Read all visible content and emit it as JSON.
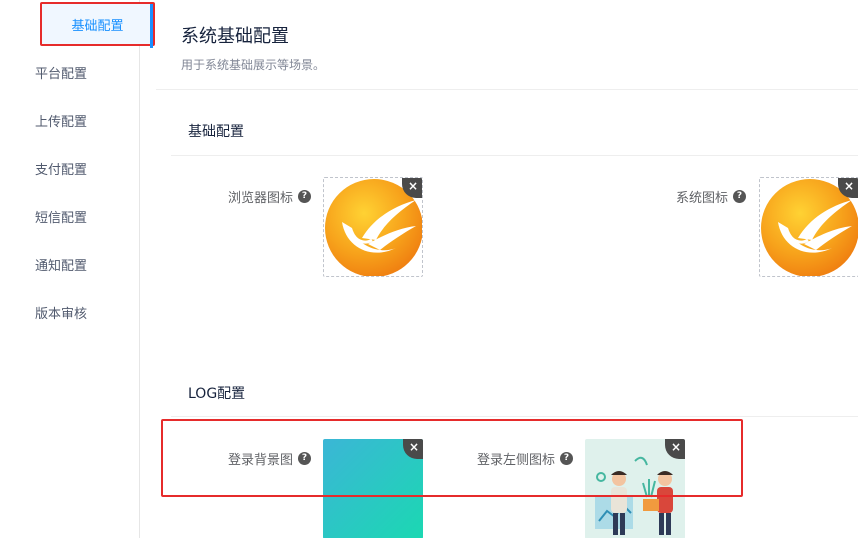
{
  "sidebar": {
    "items": [
      {
        "label": "基础配置"
      },
      {
        "label": "平台配置"
      },
      {
        "label": "上传配置"
      },
      {
        "label": "支付配置"
      },
      {
        "label": "短信配置"
      },
      {
        "label": "通知配置"
      },
      {
        "label": "版本审核"
      }
    ]
  },
  "header": {
    "title": "系统基础配置",
    "description": "用于系统基础展示等场景。"
  },
  "sections": {
    "basic": {
      "title": "基础配置",
      "fields": [
        {
          "label": "浏览器图标",
          "help": "?"
        },
        {
          "label": "系统图标",
          "help": "?"
        }
      ]
    },
    "log": {
      "title": "LOG配置",
      "fields": [
        {
          "label": "登录背景图",
          "help": "?"
        },
        {
          "label": "登录左侧图标",
          "help": "?"
        }
      ]
    }
  },
  "close_glyph": "×",
  "colors": {
    "accent": "#1890ff",
    "highlight_red": "#e62b2b",
    "logo_orange": "#f7a21b",
    "bg_gradient_start": "#3bb6d6",
    "bg_gradient_end": "#1bd8b2"
  }
}
